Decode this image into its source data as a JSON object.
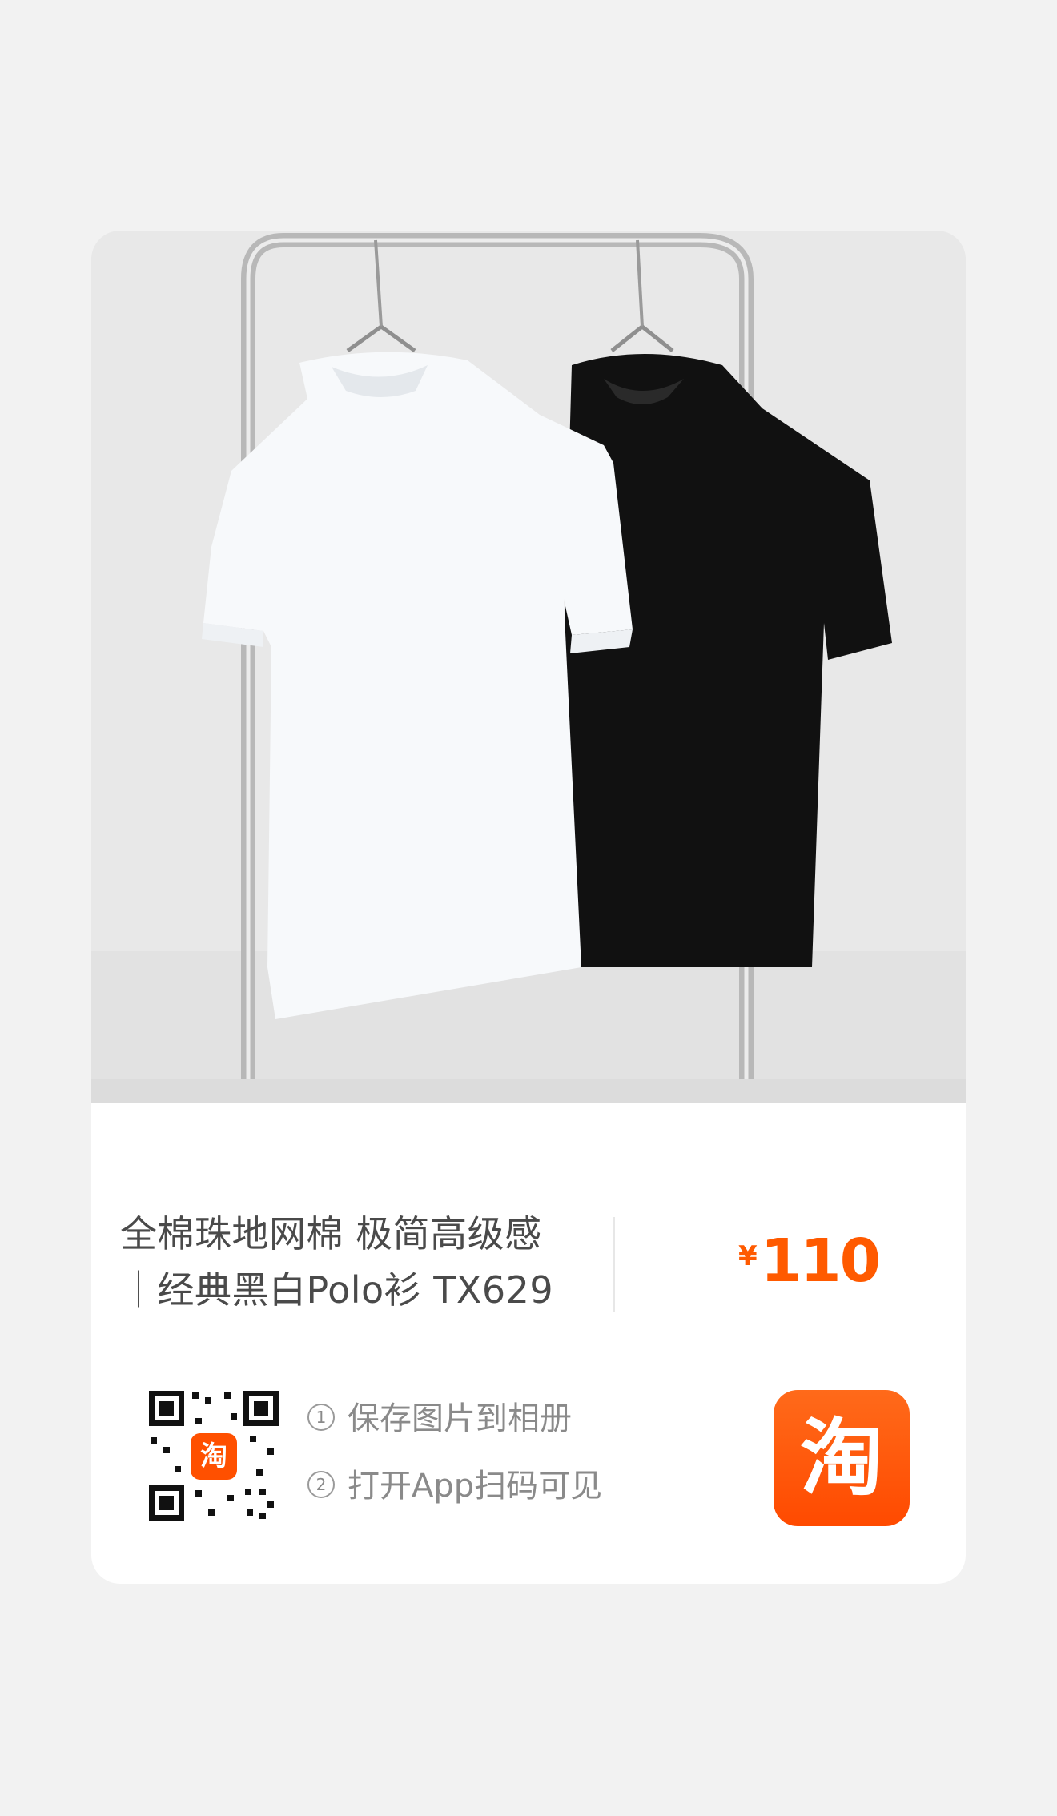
{
  "product": {
    "title_line1": "全棉珠地网棉 极简高级感",
    "title_line2": "｜经典黑白Polo衫 TX629",
    "price_symbol": "¥",
    "price_value": "110",
    "image_alt": "white and black polo shirts hanging on a rack"
  },
  "share": {
    "step1_num": "1",
    "step1_text": "保存图片到相册",
    "step2_num": "2",
    "step2_text": "打开App扫码可见",
    "qr_logo": "淘",
    "app_icon_text": "淘"
  },
  "colors": {
    "accent": "#ff5000",
    "price": "#ff5a00",
    "text": "#4a4a4a",
    "muted": "#8a8a8a"
  },
  "icons": {
    "qr_code": "qr-code-icon",
    "app": "taobao-app-icon"
  }
}
